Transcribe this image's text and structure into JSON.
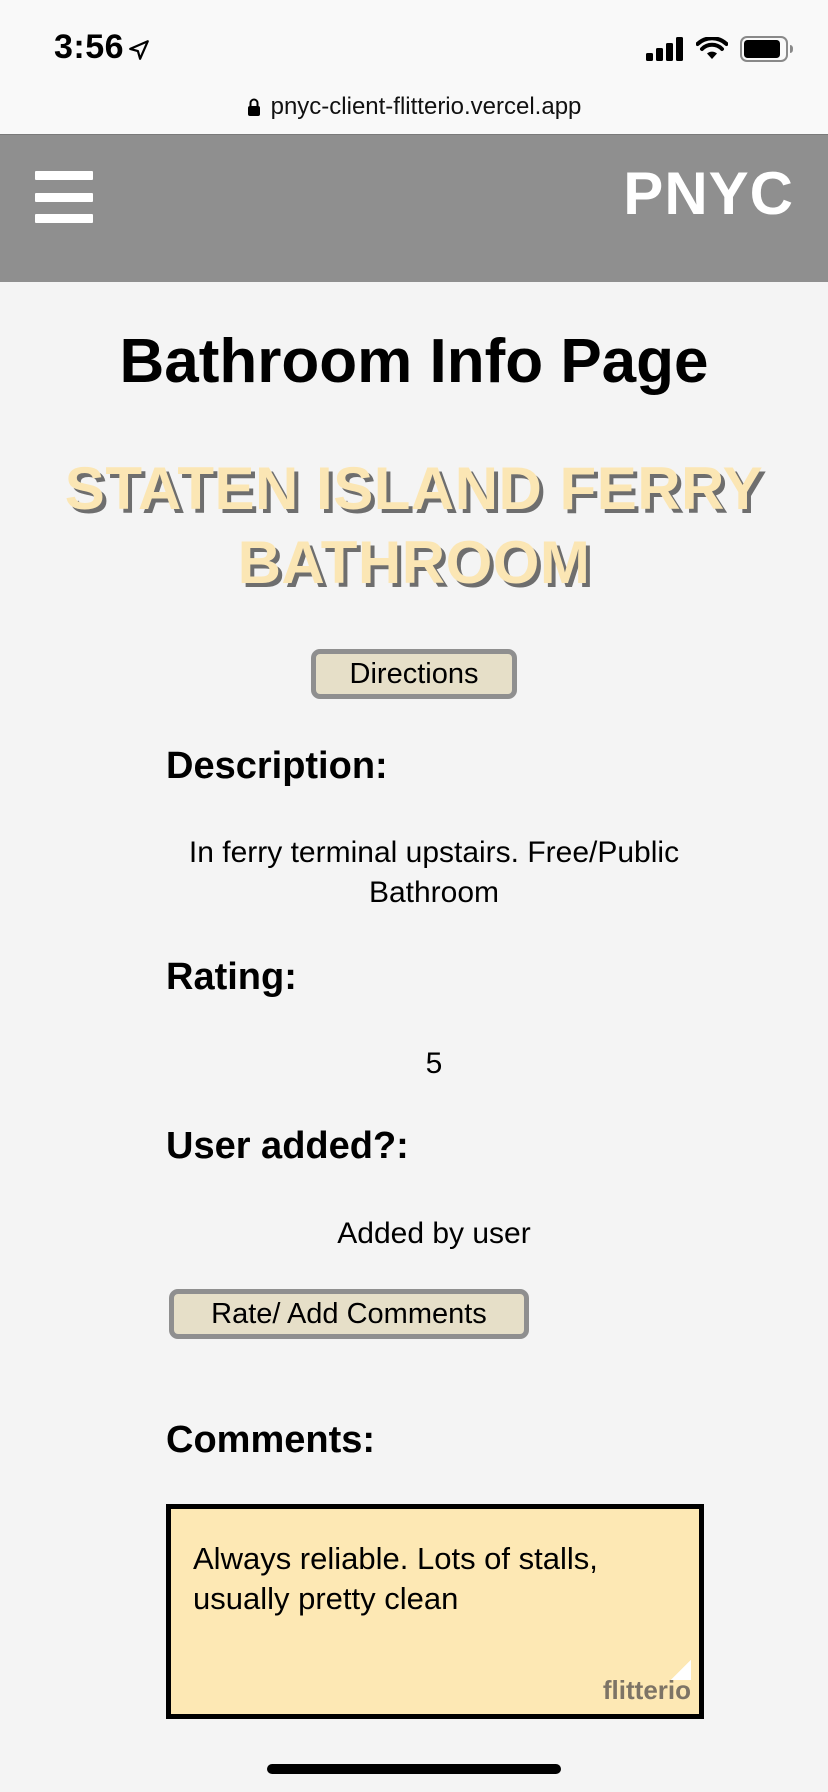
{
  "status_bar": {
    "time": "3:56",
    "icons": [
      "location-arrow-icon",
      "signal-icon",
      "wifi-icon",
      "battery-icon"
    ]
  },
  "browser": {
    "url": "pnyc-client-flitterio.vercel.app",
    "icons": [
      "lock-icon"
    ]
  },
  "nav": {
    "brand": "PNYC",
    "menu_icon": "hamburger-menu-icon",
    "background_color": "#8f8f8f"
  },
  "page": {
    "title": "Bathroom Info Page",
    "place_name": "STATEN ISLAND FERRY BATHROOM",
    "place_name_color": "#fbe6b4",
    "directions_button": "Directions",
    "description_label": "Description:",
    "description_value": "In ferry terminal upstairs. Free/Public Bathroom",
    "rating_label": "Rating:",
    "rating_value": "5",
    "user_added_label": "User added?:",
    "user_added_value": "Added by user",
    "rate_button": "Rate/ Add Comments",
    "comments_label": "Comments:",
    "button_color": "#e6dfc8"
  },
  "comments": [
    {
      "text": "Always reliable. Lots of stalls, usually pretty clean",
      "card_color": "#fde8b4"
    }
  ],
  "watermark": "flitterio"
}
